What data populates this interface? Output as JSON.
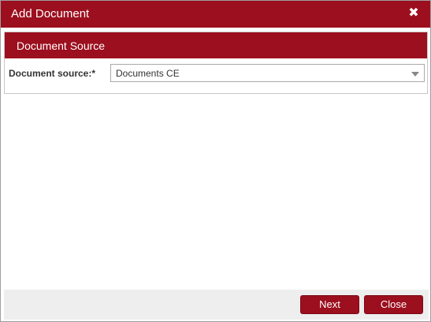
{
  "dialog": {
    "title": "Add Document",
    "close_icon": "close-x-icon"
  },
  "section": {
    "title": "Document Source",
    "field_label": "Document source:*",
    "select_value": "Documents CE"
  },
  "footer": {
    "next_label": "Next",
    "close_label": "Close"
  },
  "colors": {
    "accent": "#9c0f1e",
    "footer_bg": "#eeeeee"
  }
}
